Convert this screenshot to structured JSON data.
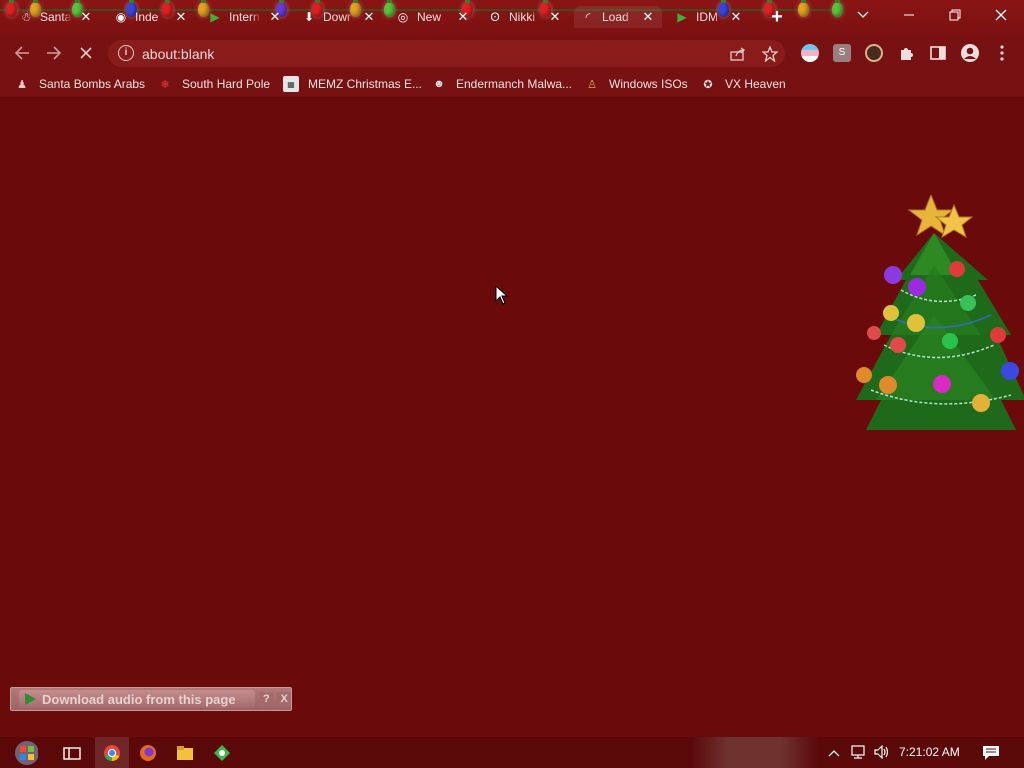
{
  "browser": {
    "tabs": [
      {
        "title": "Santa",
        "favicon": "santa-icon",
        "active": false
      },
      {
        "title": "Inde",
        "favicon": "spy-icon",
        "active": false
      },
      {
        "title": "Intern",
        "favicon": "play-icon",
        "active": false
      },
      {
        "title": "Dowr",
        "favicon": "download-icon",
        "active": false
      },
      {
        "title": "New",
        "favicon": "chrome-icon",
        "active": false
      },
      {
        "title": "Nikki",
        "favicon": "panda-icon",
        "active": false
      },
      {
        "title": "Load",
        "favicon": "loading-spinner-icon",
        "active": true
      },
      {
        "title": "IDM",
        "favicon": "idm-icon",
        "active": false
      }
    ],
    "address": "about:blank"
  },
  "bookmarks": [
    {
      "label": "Santa Bombs Arabs",
      "icon": "santa-icon"
    },
    {
      "label": "South Hard Pole",
      "icon": "snowflake-icon"
    },
    {
      "label": "MEMZ Christmas E...",
      "icon": "memz-icon"
    },
    {
      "label": "Endermanch Malwa...",
      "icon": "raccoon-icon"
    },
    {
      "label": "Windows ISOs",
      "icon": "buddha-icon"
    },
    {
      "label": "VX Heaven",
      "icon": "vx-icon"
    }
  ],
  "download_bar": {
    "label": "Download audio from this page",
    "help": "?",
    "close": "X"
  },
  "taskbar": {
    "clock": "7:21:02 AM"
  },
  "colors": {
    "content_bg": "#6b0a0a",
    "toolbar_bg": "#781212",
    "tab_strip_bg": "#8a1515",
    "taskbar_bg": "#5a0808"
  }
}
